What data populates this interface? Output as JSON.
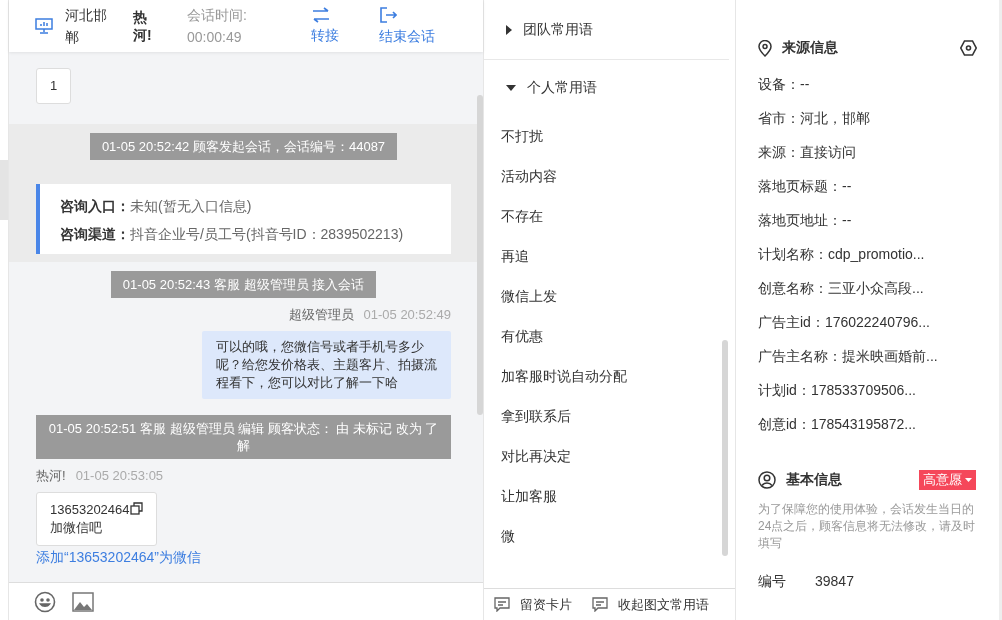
{
  "chat_header": {
    "location": "河北邯郸",
    "customer": "热河!",
    "duration_label": "会话时间:",
    "duration": "00:00:49",
    "actions": [
      {
        "kind": "transfer",
        "label": "转接"
      },
      {
        "kind": "end",
        "label": "结束会话"
      }
    ]
  },
  "messages": [
    {
      "kind": "bubble_in",
      "lines": [
        "1"
      ]
    },
    {
      "kind": "system",
      "band": true,
      "text": "01-05 20:52:42 顾客发起会话，会话编号：44087"
    },
    {
      "kind": "source_card",
      "band": true,
      "rows": [
        {
          "label": "咨询入口：",
          "value": "未知(暂无入口信息)"
        },
        {
          "label": "咨询渠道：",
          "value": "抖音企业号/员工号(抖音号ID：2839502213)"
        }
      ]
    },
    {
      "kind": "system",
      "band": false,
      "text": "01-05 20:52:43 客服 超级管理员 接入会话"
    },
    {
      "kind": "bubble_out",
      "sender": "超级管理员",
      "time": "01-05 20:52:49",
      "text": "可以的哦，您微信号或者手机号多少呢？给您发价格表、主题客片、拍摄流程看下，您可以对比了解一下哈"
    },
    {
      "kind": "system",
      "band": false,
      "text": "01-05 20:52:51 客服 超级管理员 编辑 顾客状态： 由 未标记 改为 了解"
    },
    {
      "kind": "bubble_in",
      "sender": "热河!",
      "time": "01-05 20:53:05",
      "lines": [
        "13653202464",
        "加微信吧"
      ],
      "copyable": true,
      "link": "添加“13653202464”为微信"
    }
  ],
  "phrases": {
    "groups": [
      {
        "label": "团队常用语",
        "expanded": false
      },
      {
        "label": "个人常用语",
        "expanded": true,
        "items": [
          "不打扰",
          "活动内容",
          "不存在",
          "再追",
          "微信上发",
          "有优惠",
          "加客服时说自动分配",
          "拿到联系后",
          "对比再决定",
          "让加客服",
          "微"
        ]
      }
    ],
    "footer": [
      "留资卡片",
      "收起图文常用语"
    ]
  },
  "source_info": {
    "title": "来源信息",
    "fields": [
      "设备：--",
      "省市：河北，邯郸",
      "来源：直接访问",
      "落地页标题：--",
      "落地页地址：--",
      "计划名称：cdp_promotio...",
      "创意名称：三亚小众高段...",
      "广告主id：176022240796...",
      "广告主名称：提米映画婚前...",
      "计划id：178533709506...",
      "创意id：178543195872..."
    ]
  },
  "basic_info": {
    "title": "基本信息",
    "tag": "高意愿",
    "note": "为了保障您的使用体验，会话发生当日的24点之后，顾客信息将无法修改，请及时填写",
    "fields": [
      {
        "label": "编号",
        "value": "39847"
      }
    ]
  }
}
